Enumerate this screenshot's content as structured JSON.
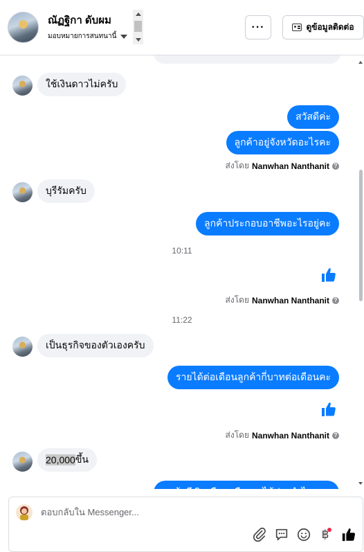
{
  "header": {
    "name": "ณัฏฐิกา ดับผม",
    "assign_label": "มอบหมายการสนทนานี้",
    "more_label": "···",
    "contact_label": "ดูข้อมูลติดต่อ"
  },
  "messages": {
    "m1": "ใช้เงินดาวไม่ครับ",
    "m2": "สวัสดีค่ะ",
    "m3": "ลูกค้าอยู่จังหวัดอะไรคะ",
    "sent_by_1": "ส่งโดย",
    "sender_1": "Nanwhan Nanthanit",
    "m4": "บุรีรัมครับ",
    "m5": "ลูกค้าประกอบอาชีพอะไรอยู่คะ",
    "time1": "10:11",
    "sent_by_2": "ส่งโดย",
    "sender_2": "Nanwhan Nanthanit",
    "time2": "11:22",
    "m6": "เป็นธุรกิจของตัวเองครับ",
    "m7": "รายได้ต่อเดือนลูกค้ากี่บาทต่อเดือนคะ",
    "sent_by_3": "ส่งโดย",
    "sender_3": "Nanwhan Nanthanit",
    "m8_highlight": "20,000",
    "m8_rest": "ขึ้น",
    "m9_partial": "ลูกค้ามีเงินเดือนหรือรายได้ประจำไหมคะ"
  },
  "composer": {
    "placeholder": "ตอบกลับใน Messenger..."
  },
  "colors": {
    "accent": "#0a7cff",
    "incoming_bubble": "#f0f2f5",
    "notification_dot": "#f02849"
  },
  "icons": [
    "attach-icon",
    "gif-icon",
    "emoji-icon",
    "baht-icon",
    "like-icon"
  ]
}
